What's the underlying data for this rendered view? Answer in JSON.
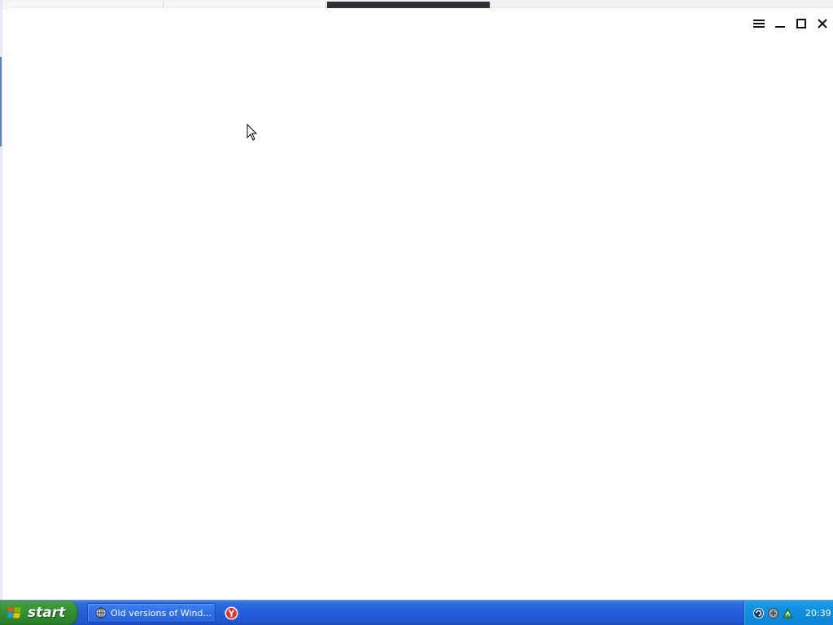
{
  "window": {
    "controls": {
      "menu_icon": "hamburger-icon",
      "minimize_icon": "minimize-icon",
      "maximize_icon": "maximize-icon",
      "close_icon": "close-icon"
    }
  },
  "taskbar": {
    "start_label": "start",
    "tasks": [
      {
        "label": "Old versions of Wind...",
        "icon": "browser-icon"
      }
    ],
    "quick_launch": [
      {
        "icon": "yandex-browser-icon"
      }
    ],
    "tray": {
      "icons": [
        "network-icon",
        "security-icon",
        "updates-icon"
      ],
      "clock": "20:39"
    }
  },
  "colors": {
    "taskbar_blue": "#245edb",
    "start_green": "#3c9a3c",
    "tray_blue": "#1090e0"
  }
}
